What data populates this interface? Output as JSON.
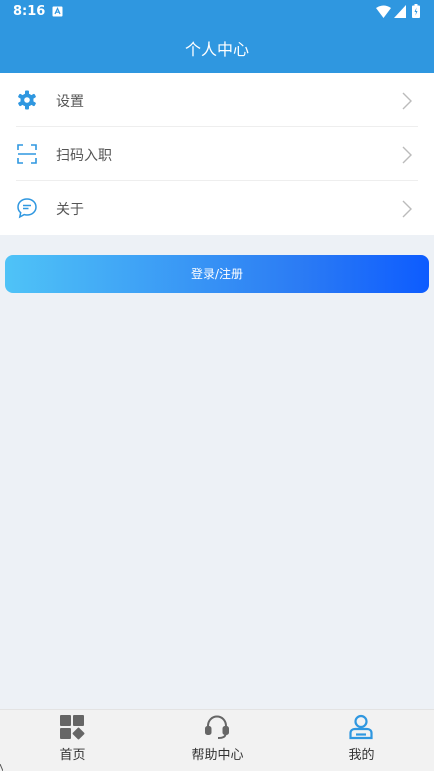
{
  "status_bar": {
    "time": "8:16",
    "icons": [
      "app-notification-icon",
      "wifi-icon",
      "signal-icon",
      "battery-icon"
    ]
  },
  "header": {
    "title": "个人中心",
    "background": "#2f97e0"
  },
  "menu": {
    "items": [
      {
        "label": "设置",
        "icon": "gear-icon"
      },
      {
        "label": "扫码入职",
        "icon": "scan-icon"
      },
      {
        "label": "关于",
        "icon": "chat-bubble-icon"
      }
    ]
  },
  "login_button": {
    "label": "登录/注册",
    "gradient": [
      "#4fc3f7",
      "#0d5cff"
    ]
  },
  "tab_bar": {
    "tabs": [
      {
        "label": "首页",
        "icon": "home-grid-icon",
        "active": false
      },
      {
        "label": "帮助中心",
        "icon": "headset-icon",
        "active": false
      },
      {
        "label": "我的",
        "icon": "user-icon",
        "active": true
      }
    ],
    "active_color": "#2f97e0",
    "inactive_color": "#666666"
  }
}
